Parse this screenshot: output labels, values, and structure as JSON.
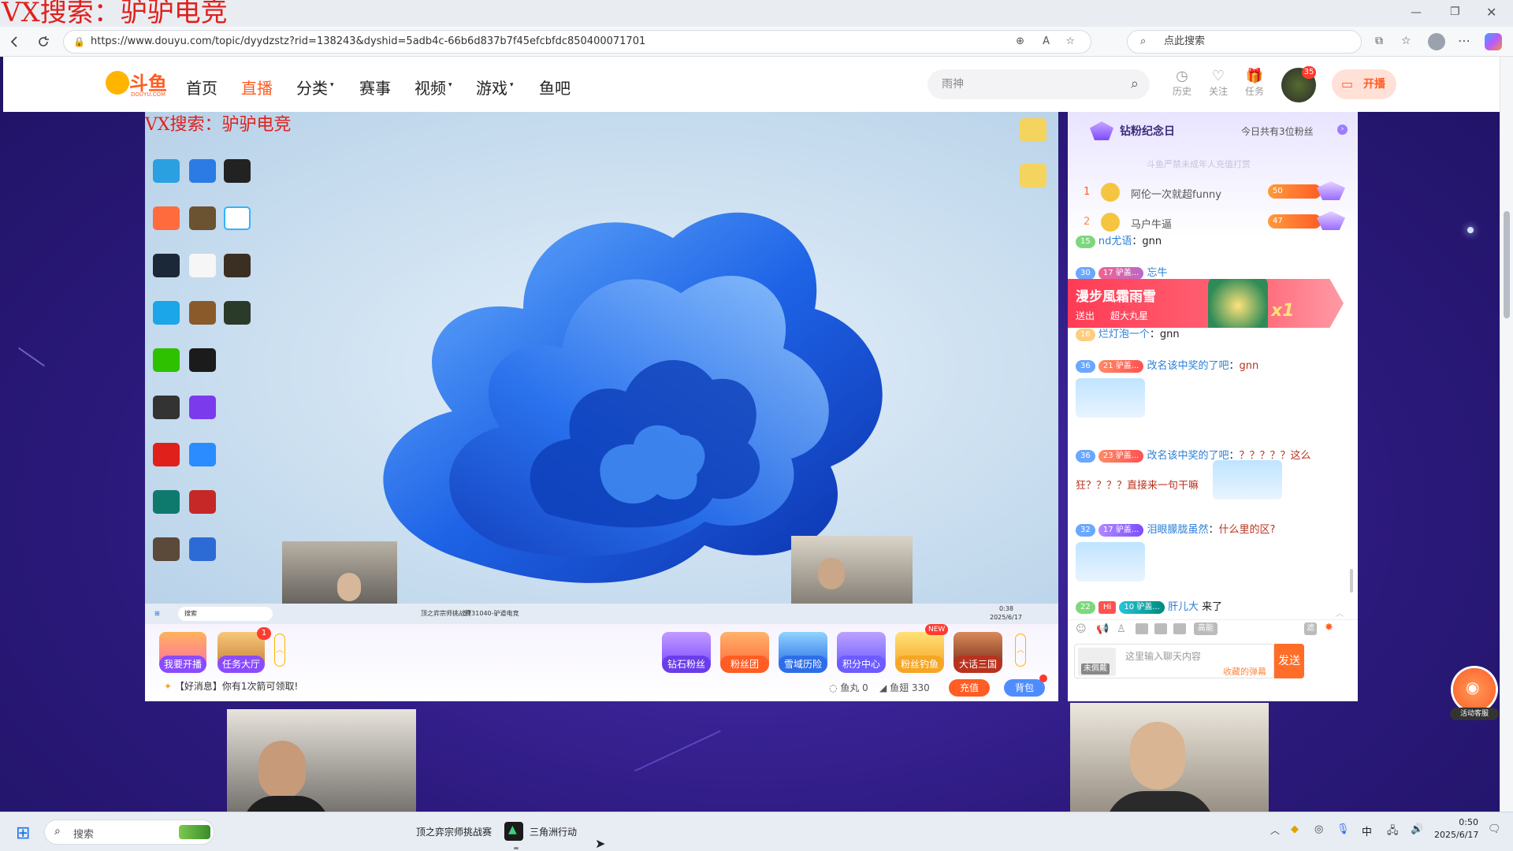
{
  "watermark": {
    "top": "VX搜索：驴驴电竞",
    "stream": "VX搜索：驴驴电竞"
  },
  "browser": {
    "url": "https://www.douyu.com/topic/dyydzstz?rid=138243&dyshid=5adb4c-66b6d837b7f45efcbfdc850400071701",
    "websearch_placeholder": "点此搜索",
    "profile_badge": ""
  },
  "header": {
    "logo_text": "斗鱼",
    "logo_sub": "DOUYU.COM",
    "nav": [
      {
        "label": "首页"
      },
      {
        "label": "直播"
      },
      {
        "label": "分类"
      },
      {
        "label": "赛事"
      },
      {
        "label": "视频"
      },
      {
        "label": "游戏"
      },
      {
        "label": "鱼吧"
      }
    ],
    "search_placeholder": "雨神",
    "history": "历史",
    "follow": "关注",
    "task": "任务",
    "avatar_badge": "35",
    "open_btn": "开播"
  },
  "desktop": {
    "taskbar_search": "搜索",
    "taskbar_app1": "顶之弈宗师挑战赛",
    "taskbar_app2": "5731040-驴道电竞",
    "clock_time": "0:38",
    "clock_date": "2025/6/17"
  },
  "toolbar": {
    "left": [
      {
        "label": "我要开播"
      },
      {
        "label": "任务大厅",
        "badge": "1"
      }
    ],
    "right": [
      {
        "label": "钻石粉丝"
      },
      {
        "label": "粉丝团"
      },
      {
        "label": "雪域历险"
      },
      {
        "label": "积分中心"
      },
      {
        "label": "粉丝钓鱼",
        "tag": "NEW"
      },
      {
        "label": "大话三国"
      }
    ],
    "notice": "【好消息】你有1次箭可领取!",
    "fish_ball_label": "鱼丸",
    "fish_ball_value": "0",
    "fish_fin_label": "鱼翅",
    "fish_fin_value": "330",
    "recharge": "充值",
    "backpack": "背包"
  },
  "chat": {
    "header_title": "钻粉纪念日",
    "header_right": "今日共有3位粉丝",
    "faded_line": "斗鱼严禁未成年人充值打赏",
    "rank": [
      {
        "rank": "1",
        "name": "阿伦一次就超funny",
        "badge": "50"
      },
      {
        "rank": "2",
        "name": "马户牛逼",
        "badge": "47"
      }
    ],
    "messages": [
      {
        "level": "15",
        "user": "nd尤语",
        "text": "gnn"
      },
      {
        "level": "30",
        "badge_level": "17",
        "badge": "驴盖...",
        "user": "忘牛",
        "text": ""
      },
      {
        "level": "16",
        "user": "烂灯泡一个",
        "text": "gnn"
      },
      {
        "level": "36",
        "badge_level": "21",
        "badge": "驴盖...",
        "user": "改名该中奖的了吧",
        "text": "gnn"
      },
      {
        "level": "36",
        "badge_level": "23",
        "badge": "驴盖...",
        "user": "改名该中奖的了吧",
        "text": "？？？？？这么狂？？？？直接来一句干嘛"
      },
      {
        "level": "32",
        "badge_level": "17",
        "badge": "驴盖...",
        "user": "泪眼朦胧虽然",
        "text": "什么里的区?"
      },
      {
        "level": "22",
        "tag": "Hi",
        "badge_level": "10",
        "badge": "驴盖...",
        "user": "肝儿大",
        "text": "来了"
      }
    ],
    "gift_banner": {
      "title": "漫步風霜雨雪",
      "sub1": "送出",
      "sub2": "超大丸星",
      "count": "x1"
    },
    "tools": {
      "high": "高能",
      "filter": "滤"
    },
    "input_placeholder": "这里输入聊天内容",
    "wear": "未佩戴",
    "collect": "收藏的弹幕",
    "send": "发送",
    "service": "活动客服"
  },
  "taskbar": {
    "search": "搜索",
    "app1": "顶之弈宗师挑战赛",
    "app2": "三角洲行动",
    "ime": "中",
    "time": "0:50",
    "date": "2025/6/17"
  },
  "colors": {
    "douyu_orange": "#ff5d23",
    "chat_user": "#2b7fd6",
    "send_btn": "#ff6d28"
  }
}
